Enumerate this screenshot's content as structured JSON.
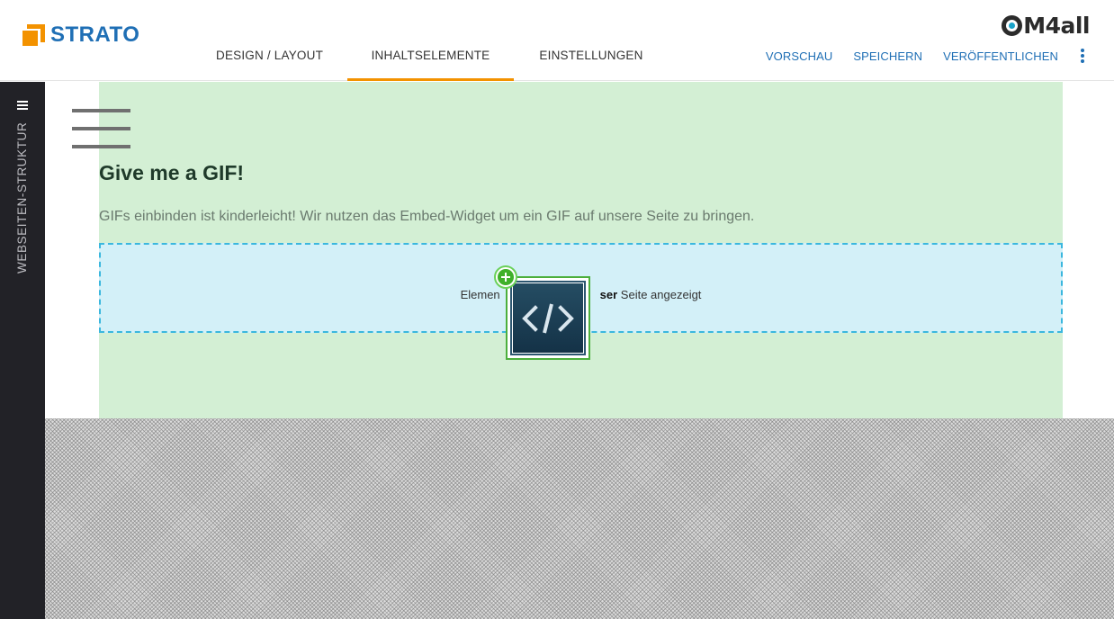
{
  "header": {
    "brand": "STRATO",
    "partner_brand": "M4all",
    "tabs": [
      {
        "label": "DESIGN / LAYOUT",
        "active": false
      },
      {
        "label": "INHALTSELEMENTE",
        "active": true
      },
      {
        "label": "EINSTELLUNGEN",
        "active": false
      }
    ],
    "actions": {
      "preview": "VORSCHAU",
      "save": "SPEICHERN",
      "publish": "VERÖFFENTLICHEN",
      "more_icon": "kebab-vertical-icon"
    }
  },
  "sidebar": {
    "menu_icon": "hamburger-icon",
    "label": "WEBSEITEN-STRUKTUR"
  },
  "page": {
    "heading": "Give me a GIF!",
    "paragraph": "GIFs einbinden ist kinderleicht! Wir nutzen das Embed-Widget um ein GIF auf unsere Seite zu bringen.",
    "embed": {
      "text_before": "Elemen",
      "text_bold": "ser",
      "text_after": " Seite angezeigt"
    },
    "drag_widget_icon": "code-embed-icon",
    "drop_badge_icon": "plus-circle-icon"
  },
  "colors": {
    "brand_orange": "#f39200",
    "brand_blue": "#1f6fb5",
    "section_green": "#d3efd4",
    "embed_blue": "#d3f0f8",
    "sidebar_dark": "#222227",
    "drop_green": "#3fb02a"
  }
}
